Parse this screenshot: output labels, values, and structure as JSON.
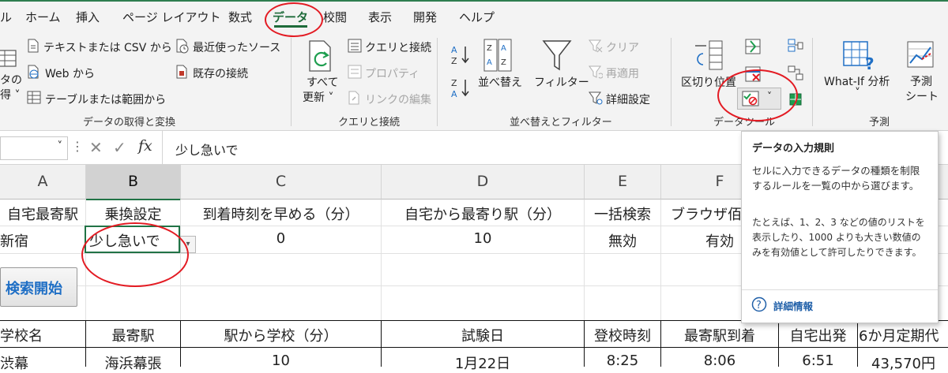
{
  "tabs": [
    "ル",
    "ホーム",
    "挿入",
    "ページ レイアウト",
    "数式",
    "データ",
    "校閲",
    "表示",
    "開発",
    "ヘルプ"
  ],
  "active_tab": "データ",
  "ribbon": {
    "get_transform": {
      "partial_label_1": "タの",
      "partial_label_2": "得 ˅",
      "from_text_csv": "テキストまたは CSV から",
      "from_web": "Web から",
      "from_table": "テーブルまたは範囲から",
      "recent_sources": "最近使ったソース",
      "existing_connections": "既存の接続",
      "group_label": "データの取得と変換"
    },
    "queries": {
      "refresh_all_1": "すべて",
      "refresh_all_2": "更新 ˅",
      "queries_connections": "クエリと接続",
      "properties": "プロパティ",
      "edit_links": "リンクの編集",
      "group_label": "クエリと接続"
    },
    "sort_filter": {
      "sort": "並べ替え",
      "filter": "フィルター",
      "clear": "クリア",
      "reapply": "再適用",
      "advanced": "詳細設定",
      "group_label": "並べ替えとフィルター"
    },
    "data_tools": {
      "text_to_columns": "区切り位置",
      "group_label": "データツール"
    },
    "forecast": {
      "what_if": "What-If 分析",
      "what_if_caret": "˅",
      "forecast_sheet_1": "予測",
      "forecast_sheet_2": "シート",
      "group_label": "予測"
    }
  },
  "formula_bar": {
    "fx": "fx",
    "content": "少し急いで"
  },
  "columns": [
    "A",
    "B",
    "C",
    "D",
    "E",
    "F"
  ],
  "rows": {
    "header": [
      "自宅最寄駅",
      "乗換設定",
      "到着時刻を早める（分）",
      "自宅から最寄り駅（分）",
      "一括検索",
      "ブラウザ佰"
    ],
    "values": [
      "新宿",
      "少し急いで",
      "0",
      "10",
      "無効",
      "有効"
    ]
  },
  "search_button": "検索開始",
  "table": {
    "headers": [
      "学校名",
      "最寄駅",
      "駅から学校（分）",
      "試験日",
      "登校時刻",
      "最寄駅到着",
      "自宅出発",
      "6か月定期代"
    ],
    "row1": [
      "渋幕",
      "海浜幕張",
      "10",
      "1月22日",
      "8:25",
      "8:06",
      "6:51",
      "43,570円"
    ]
  },
  "tooltip": {
    "title": "データの入力規則",
    "body1": "セルに入力できるデータの種類を制限するルールを一覧の中から選びます。",
    "body2": "たとえば、1、2、3 などの値のリストを表示したり、1000 よりも大きい数値のみを有効値として許可したりできます。",
    "link": "詳細情報"
  },
  "colors": {
    "accent_green": "#1e6b3a",
    "annotation_red": "#e31b23",
    "selected_cell_border": "#217346",
    "search_button_text": "#1f6fc5",
    "link_blue": "#1f5fa8"
  }
}
